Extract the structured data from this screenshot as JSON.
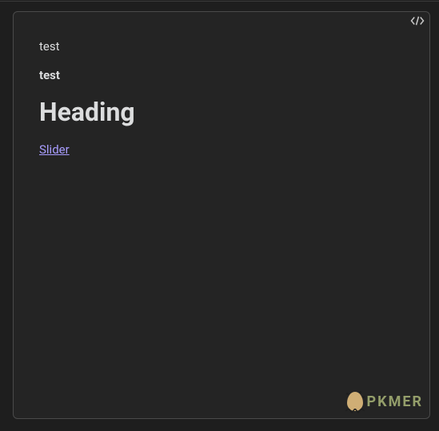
{
  "preview": {
    "line1": "test",
    "line2_bold": "test",
    "heading": "Heading",
    "link_text": "Slider"
  },
  "watermark": {
    "text": "PKMER"
  }
}
